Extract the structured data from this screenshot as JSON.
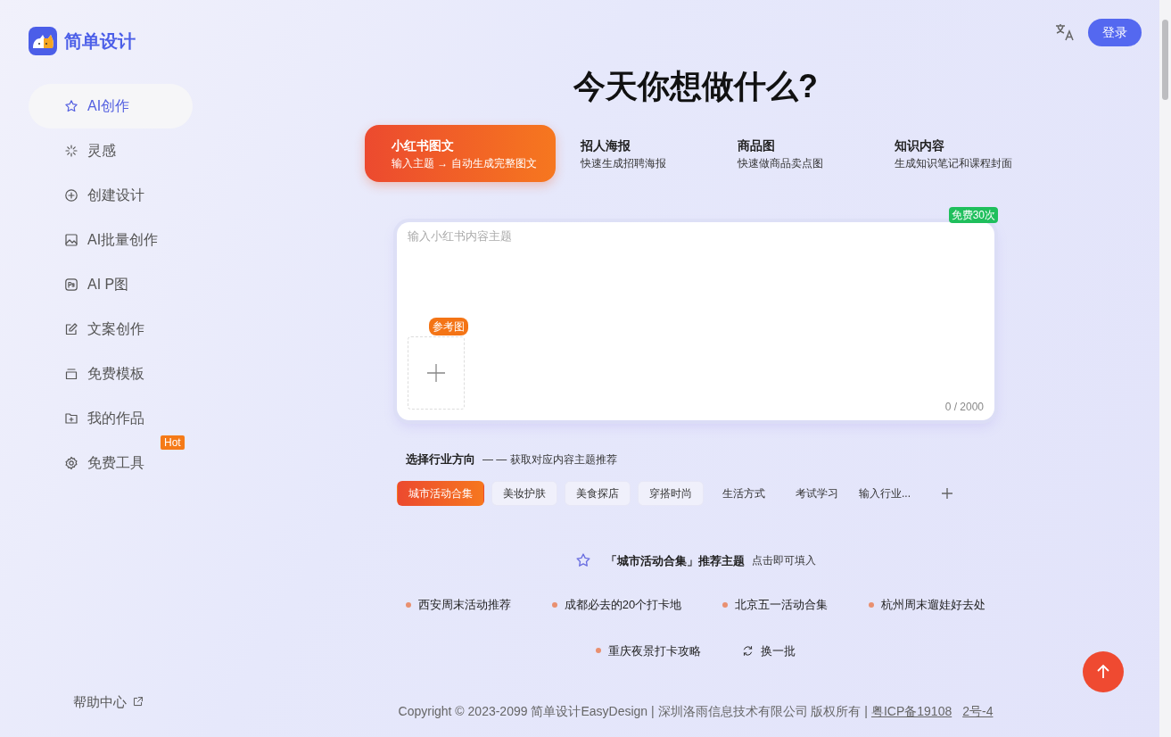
{
  "brand": {
    "name": "简单设计"
  },
  "sidebar": {
    "items": [
      {
        "label": "AI创作",
        "selected": true
      },
      {
        "label": "灵感",
        "selected": false
      },
      {
        "label": "创建设计",
        "selected": false
      },
      {
        "label": "AI批量创作",
        "selected": false
      },
      {
        "label": "AI P图",
        "selected": false
      },
      {
        "label": "文案创作",
        "selected": false
      },
      {
        "label": "免费模板",
        "selected": false
      },
      {
        "label": "我的作品",
        "selected": false
      },
      {
        "label": "免费工具",
        "selected": false,
        "badge": "Hot"
      }
    ],
    "help": "帮助中心"
  },
  "header": {
    "login": "登录"
  },
  "heading": "今天你想做什么?",
  "tabs": [
    {
      "title": "小红书图文",
      "subtitle": "输入主题 → 自动生成完整图文",
      "selected": true
    },
    {
      "title": "招人海报",
      "subtitle": "快速生成招聘海报",
      "selected": false
    },
    {
      "title": "商品图",
      "subtitle": "快速做商品卖点图",
      "selected": false
    },
    {
      "title": "知识内容",
      "subtitle": "生成知识笔记和课程封面",
      "selected": false
    }
  ],
  "editor": {
    "placeholder": "输入小红书内容主题",
    "free_badge": "免费30次",
    "reference_label": "参考图",
    "counter": "0 / 2000"
  },
  "industry": {
    "title": "选择行业方向",
    "hint": "— — 获取对应内容主题推荐",
    "chips": [
      {
        "label": "城市活动合集",
        "selected": true
      },
      {
        "label": "美妆护肤",
        "selected": false
      },
      {
        "label": "美食探店",
        "selected": false
      },
      {
        "label": "穿搭时尚",
        "selected": false
      },
      {
        "label": "生活方式",
        "selected": false
      },
      {
        "label": "考试学习",
        "selected": false
      }
    ],
    "custom_placeholder": "输入行业..."
  },
  "recommend": {
    "title": "「城市活动合集」推荐主题",
    "hint": "点击即可填入",
    "topics": [
      "西安周末活动推荐",
      "成都必去的20个打卡地",
      "北京五一活动合集",
      "杭州周末遛娃好去处",
      "重庆夜景打卡攻略"
    ],
    "refresh": "换一批"
  },
  "footer": {
    "copyright": "Copyright © 2023-2099 简单设计EasyDesign | 深圳洛雨信息技术有限公司 版权所有 |",
    "icp_start": "粤ICP备19108",
    "icp_end": "2号-4"
  }
}
